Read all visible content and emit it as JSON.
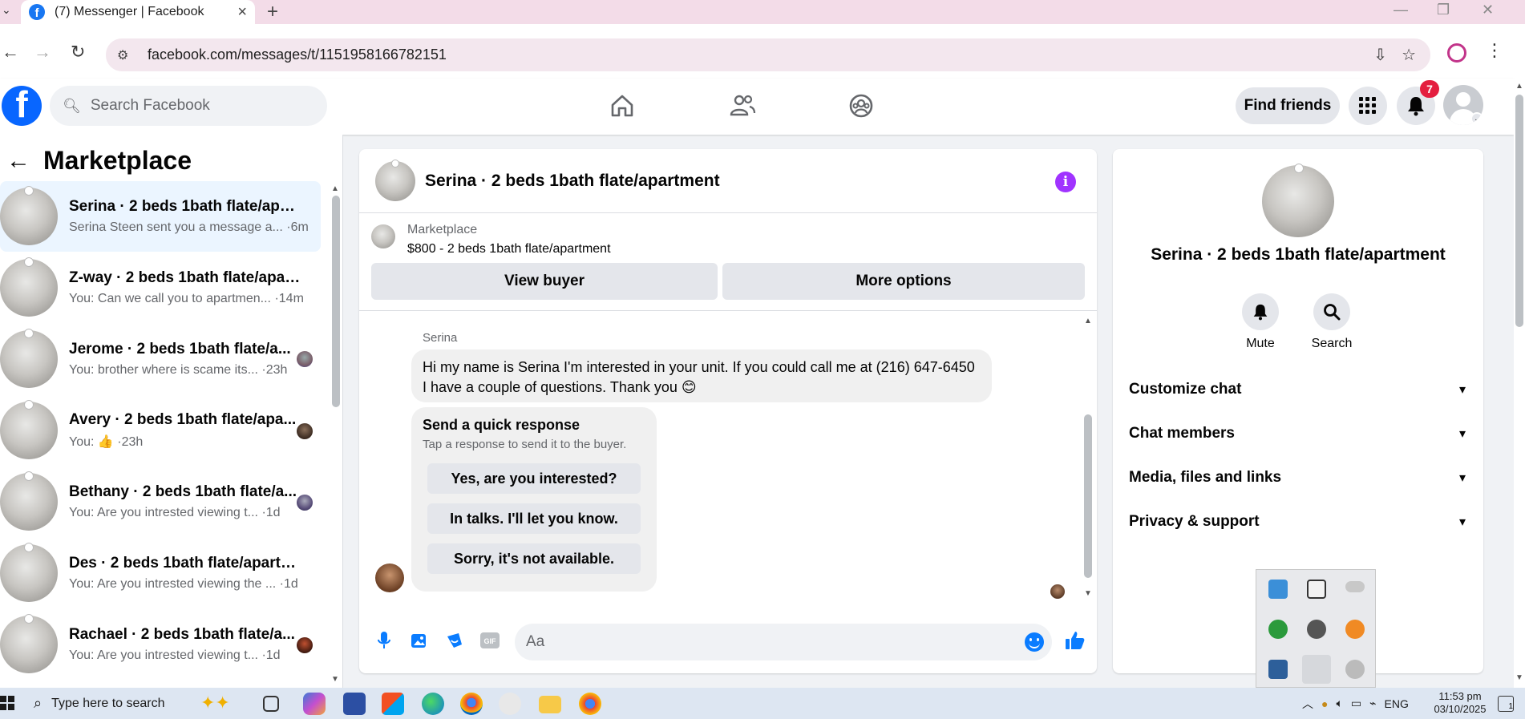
{
  "browser": {
    "tab_title": "(7) Messenger | Facebook",
    "url": "facebook.com/messages/t/1151958166782151"
  },
  "header": {
    "search_placeholder": "Search Facebook",
    "find_friends": "Find friends",
    "notification_count": "7",
    "nav_icons": [
      "home-icon",
      "friends-icon",
      "groups-icon"
    ]
  },
  "sidebar": {
    "title": "Marketplace",
    "conversations": [
      {
        "name": "Serina · 2 beds 1bath flate/apart...",
        "snippet": "Serina Steen sent you a message a... ·6m",
        "active": true
      },
      {
        "name": "Z-way · 2 beds 1bath flate/apart...",
        "snippet": "You: Can we call you to apartmen... ·14m",
        "active": false
      },
      {
        "name": "Jerome · 2 beds 1bath flate/a...",
        "snippet": "You: brother where is scame its... ·23h",
        "active": false
      },
      {
        "name": "Avery · 2 beds 1bath flate/apa...",
        "snippet": "You: 👍 ·23h",
        "active": false
      },
      {
        "name": "Bethany · 2 beds 1bath flate/a...",
        "snippet": "You: Are you intrested viewing t... ·1d",
        "active": false
      },
      {
        "name": "Des · 2 beds 1bath flate/apartm...",
        "snippet": "You: Are you intrested viewing the ... ·1d",
        "active": false
      },
      {
        "name": "Rachael · 2 beds 1bath flate/a...",
        "snippet": "You: Are you intrested viewing t... ·1d",
        "active": false
      }
    ]
  },
  "chat": {
    "title": "Serina · 2 beds 1bath flate/apartment",
    "listing_category": "Marketplace",
    "listing_price": "$800 - 2 beds 1bath flate/apartment",
    "view_buyer": "View buyer",
    "more_options": "More options",
    "sender_name": "Serina",
    "message": "Hi my name is Serina I'm interested in your unit. If you could call me at (216) 647-6450 I have a couple of questions. Thank you 😊",
    "quick_title": "Send a quick response",
    "quick_subtitle": "Tap a response to send it to the buyer.",
    "quick_options": [
      "Yes, are you interested?",
      "In talks. I'll let you know.",
      "Sorry, it's not available."
    ],
    "input_placeholder": "Aa"
  },
  "info_panel": {
    "title": "Serina · 2 beds 1bath flate/apartment",
    "mute": "Mute",
    "search": "Search",
    "sections": [
      "Customize chat",
      "Chat members",
      "Media, files and links",
      "Privacy & support"
    ]
  },
  "taskbar": {
    "search_placeholder": "Type here to search",
    "language": "ENG",
    "time": "11:53 pm",
    "date": "03/10/2025",
    "notification_count": "1"
  },
  "colors": {
    "facebook_blue": "#0866ff",
    "messenger_blue": "#0a7cff",
    "badge_red": "#e41e3f",
    "active_conversation": "#ebf5ff"
  }
}
